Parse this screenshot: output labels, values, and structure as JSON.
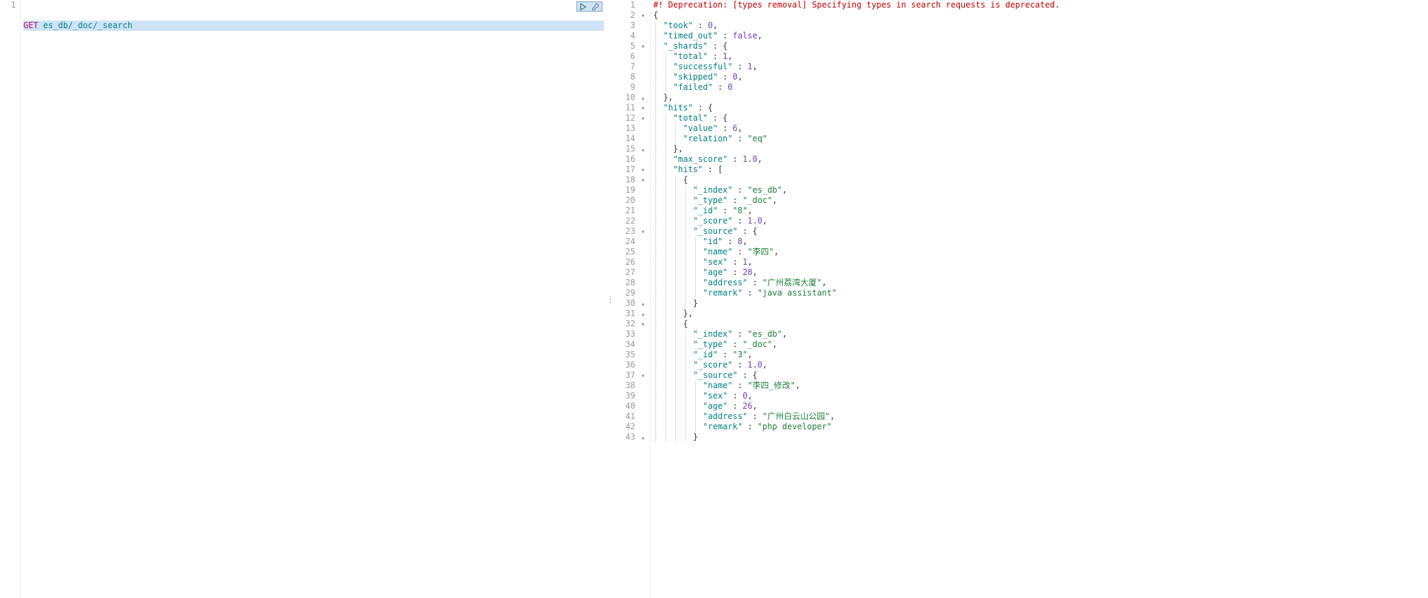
{
  "left": {
    "gutter": [
      "1"
    ],
    "request": {
      "method": "GET",
      "path": "es_db/_doc/_search"
    }
  },
  "right": {
    "deprecation": "#! Deprecation: [types removal] Specifying types in search requests is deprecated.",
    "lines": [
      {
        "n": 1,
        "fold": "",
        "tokens": [
          {
            "t": "depr",
            "bind": "right.deprecation"
          }
        ]
      },
      {
        "n": 2,
        "fold": "▾",
        "raw": "{"
      },
      {
        "n": 3,
        "fold": "",
        "indent": 1,
        "key": "took",
        "sep": " : ",
        "valnum": "0",
        "trail": ","
      },
      {
        "n": 4,
        "fold": "",
        "indent": 1,
        "key": "timed_out",
        "sep": " : ",
        "valbool": "false",
        "trail": ","
      },
      {
        "n": 5,
        "fold": "▾",
        "indent": 1,
        "key": "_shards",
        "sep": " : ",
        "open": "{"
      },
      {
        "n": 6,
        "fold": "",
        "indent": 2,
        "key": "total",
        "sep": " : ",
        "valnum": "1",
        "trail": ","
      },
      {
        "n": 7,
        "fold": "",
        "indent": 2,
        "key": "successful",
        "sep": " : ",
        "valnum": "1",
        "trail": ","
      },
      {
        "n": 8,
        "fold": "",
        "indent": 2,
        "key": "skipped",
        "sep": " : ",
        "valnum": "0",
        "trail": ","
      },
      {
        "n": 9,
        "fold": "",
        "indent": 2,
        "key": "failed",
        "sep": " : ",
        "valnum": "0"
      },
      {
        "n": 10,
        "fold": "▴",
        "indent": 1,
        "raw": "},"
      },
      {
        "n": 11,
        "fold": "▾",
        "indent": 1,
        "key": "hits",
        "sep": " : ",
        "open": "{"
      },
      {
        "n": 12,
        "fold": "▾",
        "indent": 2,
        "key": "total",
        "sep": " : ",
        "open": "{"
      },
      {
        "n": 13,
        "fold": "",
        "indent": 3,
        "key": "value",
        "sep": " : ",
        "valnum": "6",
        "trail": ","
      },
      {
        "n": 14,
        "fold": "",
        "indent": 3,
        "key": "relation",
        "sep": " : ",
        "valstr": "eq"
      },
      {
        "n": 15,
        "fold": "▴",
        "indent": 2,
        "raw": "},"
      },
      {
        "n": 16,
        "fold": "",
        "indent": 2,
        "key": "max_score",
        "sep": " : ",
        "valnum": "1.0",
        "trail": ","
      },
      {
        "n": 17,
        "fold": "▾",
        "indent": 2,
        "key": "hits",
        "sep": " : ",
        "open": "["
      },
      {
        "n": 18,
        "fold": "▾",
        "indent": 3,
        "raw": "{"
      },
      {
        "n": 19,
        "fold": "",
        "indent": 4,
        "key": "_index",
        "sep": " : ",
        "valstr": "es_db",
        "trail": ","
      },
      {
        "n": 20,
        "fold": "",
        "indent": 4,
        "key": "_type",
        "sep": " : ",
        "valstr": "_doc",
        "trail": ","
      },
      {
        "n": 21,
        "fold": "",
        "indent": 4,
        "key": "_id",
        "sep": " : ",
        "valstr": "8",
        "trail": ","
      },
      {
        "n": 22,
        "fold": "",
        "indent": 4,
        "key": "_score",
        "sep": " : ",
        "valnum": "1.0",
        "trail": ","
      },
      {
        "n": 23,
        "fold": "▾",
        "indent": 4,
        "key": "_source",
        "sep": " : ",
        "open": "{"
      },
      {
        "n": 24,
        "fold": "",
        "indent": 5,
        "key": "id",
        "sep": " : ",
        "valnum": "8",
        "trail": ","
      },
      {
        "n": 25,
        "fold": "",
        "indent": 5,
        "key": "name",
        "sep": " : ",
        "valstr": "李四",
        "trail": ","
      },
      {
        "n": 26,
        "fold": "",
        "indent": 5,
        "key": "sex",
        "sep": " : ",
        "valnum": "1",
        "trail": ","
      },
      {
        "n": 27,
        "fold": "",
        "indent": 5,
        "key": "age",
        "sep": " : ",
        "valnum": "28",
        "trail": ","
      },
      {
        "n": 28,
        "fold": "",
        "indent": 5,
        "key": "address",
        "sep": " : ",
        "valstr": "广州荔湾大厦",
        "trail": ","
      },
      {
        "n": 29,
        "fold": "",
        "indent": 5,
        "key": "remark",
        "sep": " : ",
        "valstr": "java assistant"
      },
      {
        "n": 30,
        "fold": "▴",
        "indent": 4,
        "raw": "}"
      },
      {
        "n": 31,
        "fold": "▴",
        "indent": 3,
        "raw": "},"
      },
      {
        "n": 32,
        "fold": "▾",
        "indent": 3,
        "raw": "{"
      },
      {
        "n": 33,
        "fold": "",
        "indent": 4,
        "key": "_index",
        "sep": " : ",
        "valstr": "es_db",
        "trail": ","
      },
      {
        "n": 34,
        "fold": "",
        "indent": 4,
        "key": "_type",
        "sep": " : ",
        "valstr": "_doc",
        "trail": ","
      },
      {
        "n": 35,
        "fold": "",
        "indent": 4,
        "key": "_id",
        "sep": " : ",
        "valstr": "3",
        "trail": ","
      },
      {
        "n": 36,
        "fold": "",
        "indent": 4,
        "key": "_score",
        "sep": " : ",
        "valnum": "1.0",
        "trail": ","
      },
      {
        "n": 37,
        "fold": "▾",
        "indent": 4,
        "key": "_source",
        "sep": " : ",
        "open": "{"
      },
      {
        "n": 38,
        "fold": "",
        "indent": 5,
        "key": "name",
        "sep": " : ",
        "valstr": "李四_修改",
        "trail": ","
      },
      {
        "n": 39,
        "fold": "",
        "indent": 5,
        "key": "sex",
        "sep": " : ",
        "valnum": "0",
        "trail": ","
      },
      {
        "n": 40,
        "fold": "",
        "indent": 5,
        "key": "age",
        "sep": " : ",
        "valnum": "26",
        "trail": ","
      },
      {
        "n": 41,
        "fold": "",
        "indent": 5,
        "key": "address",
        "sep": " : ",
        "valstr": "广州白云山公园",
        "trail": ","
      },
      {
        "n": 42,
        "fold": "",
        "indent": 5,
        "key": "remark",
        "sep": " : ",
        "valstr": "php developer"
      },
      {
        "n": 43,
        "fold": "▴",
        "indent": 4,
        "raw": "}"
      }
    ],
    "response_json": {
      "took": 0,
      "timed_out": false,
      "_shards": {
        "total": 1,
        "successful": 1,
        "skipped": 0,
        "failed": 0
      },
      "hits": {
        "total": {
          "value": 6,
          "relation": "eq"
        },
        "max_score": 1.0,
        "hits": [
          {
            "_index": "es_db",
            "_type": "_doc",
            "_id": "8",
            "_score": 1.0,
            "_source": {
              "id": 8,
              "name": "李四",
              "sex": 1,
              "age": 28,
              "address": "广州荔湾大厦",
              "remark": "java assistant"
            }
          },
          {
            "_index": "es_db",
            "_type": "_doc",
            "_id": "3",
            "_score": 1.0,
            "_source": {
              "name": "李四_修改",
              "sex": 0,
              "age": 26,
              "address": "广州白云山公园",
              "remark": "php developer"
            }
          }
        ]
      }
    }
  }
}
